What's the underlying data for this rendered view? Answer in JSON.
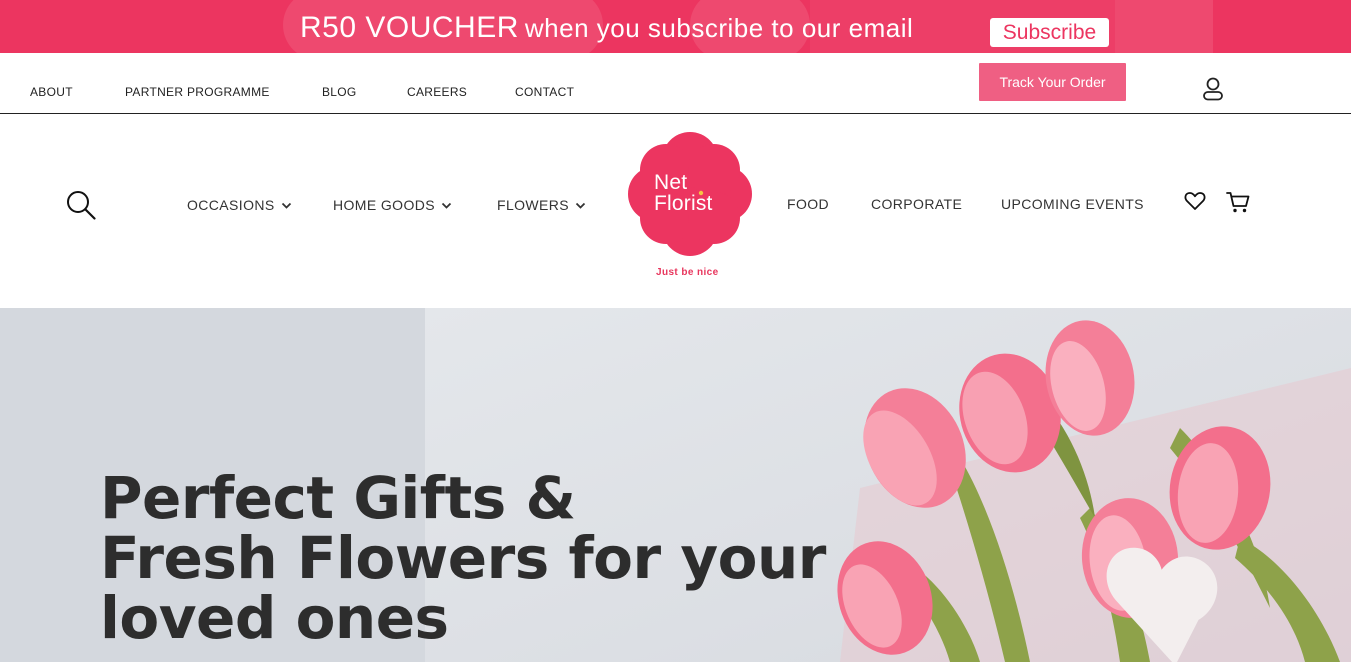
{
  "promo": {
    "headline": "R50 VOUCHER",
    "text": "when you subscribe to our email",
    "subscribe_label": "Subscribe"
  },
  "utility_nav": {
    "items": [
      "ABOUT",
      "PARTNER PROGRAMME",
      "BLOG",
      "CAREERS",
      "CONTACT"
    ],
    "track_order_label": "Track Your Order"
  },
  "main_nav": {
    "left_items": [
      "OCCASIONS",
      "HOME GOODS",
      "FLOWERS"
    ],
    "right_items": [
      "FOOD",
      "CORPORATE",
      "UPCOMING EVENTS"
    ]
  },
  "logo": {
    "line1": "Net",
    "line2": "Florist",
    "tagline": "Just be nice"
  },
  "hero": {
    "title_line1": "Perfect Gifts &",
    "title_line2": "Fresh Flowers for your",
    "title_line3": "loved ones"
  },
  "icons": {
    "search": "search-icon",
    "user": "user-icon",
    "heart": "heart-icon",
    "cart": "cart-icon",
    "chevron": "chevron-down-icon"
  },
  "colors": {
    "brand_pink": "#ec3560",
    "button_pink": "#ef5f83",
    "hero_bg": "#dde0e5",
    "text_dark": "#2d2d2d"
  }
}
